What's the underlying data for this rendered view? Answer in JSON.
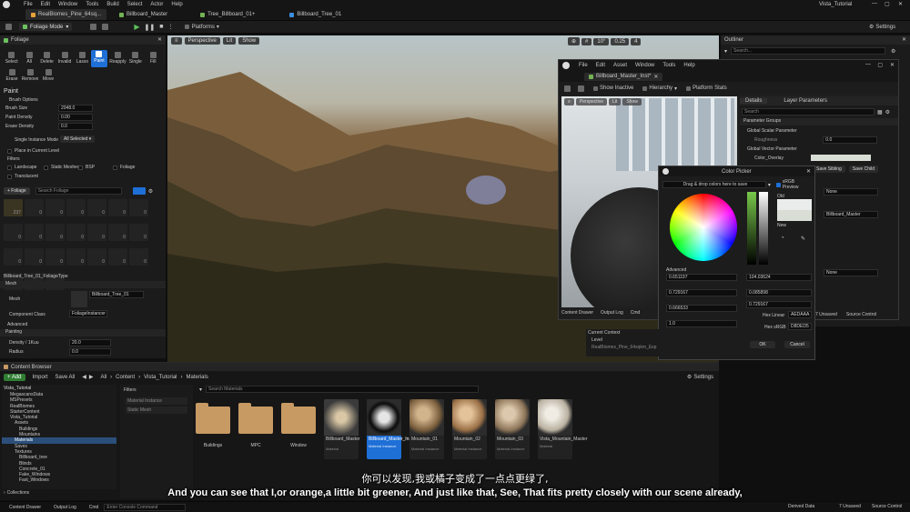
{
  "menubar": {
    "items": [
      "File",
      "Edit",
      "Window",
      "Tools",
      "Build",
      "Select",
      "Actor",
      "Help"
    ],
    "app_title": "Vista_Tutorial"
  },
  "tabs": [
    "RealBiomes_Pine_64sq...",
    "Billboard_Master",
    "Tree_Billboard_01+",
    "Billboard_Tree_01"
  ],
  "toolbar": {
    "mode": "Foliage Mode",
    "platforms": "Platforms",
    "settings": "Settings"
  },
  "viewport": {
    "perspective": "Perspective",
    "lit": "Lit",
    "show": "Show",
    "fov": "10°",
    "scale": "0.25",
    "snap": "4"
  },
  "foliage_panel": {
    "title": "Foliage",
    "tools": [
      "Select",
      "All",
      "Delete",
      "Invalid",
      "Lasso",
      "Paint",
      "Reapply",
      "Single",
      "Fill",
      "Erase",
      "Remove",
      "Move"
    ],
    "section_paint": "Paint",
    "brush_options": "Brush Options",
    "brush_size_label": "Brush Size",
    "brush_size": "2048.0",
    "paint_density_label": "Paint Density",
    "paint_density": "0.00",
    "erase_density_label": "Erase Density",
    "erase_density": "0.0",
    "single_instance_mode": "Single Instance Mode",
    "all_selected": "All Selected",
    "place_in_level": "Place in Current Level",
    "filters": "Filters",
    "filter_items": [
      "Landscape",
      "Static Meshes",
      "BSP",
      "Foliage",
      "Translucent"
    ],
    "add_foliage": "+ Foliage",
    "search_placeholder": "Search Foliage",
    "grid_counts": [
      "237",
      "0",
      "0",
      "0",
      "0",
      "0",
      "0",
      "0",
      "0",
      "0",
      "0",
      "0",
      "0",
      "0",
      "0",
      "0",
      "0",
      "0",
      "0",
      "0",
      "0",
      "0",
      "0",
      "0"
    ],
    "foliage_type_title": "Billboard_Tree_01_FoliageType",
    "mesh_section": "Mesh",
    "mesh_label": "Mesh",
    "mesh_value": "Billboard_Tree_01",
    "component_class_label": "Component Class",
    "component_class_value": "FoliageInstancer",
    "advanced": "Advanced",
    "painting": "Painting",
    "density_label": "Density / 1Kuu",
    "density_value": "20.0",
    "radius_label": "Radius",
    "radius_value": "0.0"
  },
  "outliner": {
    "title": "Outliner",
    "search_placeholder": "Search..."
  },
  "material_window": {
    "menu": [
      "File",
      "Edit",
      "Asset",
      "Window",
      "Tools",
      "Help"
    ],
    "tab": "Billboard_Master_Inst*",
    "buttons": [
      "Show Inactive",
      "Hierarchy",
      "Platform Stats"
    ],
    "viewport_perspective": "Perspective",
    "viewport_lit": "Lit",
    "viewport_show": "Show",
    "details": "Details",
    "layer_parameters": "Layer Parameters",
    "search_placeholder": "Search",
    "parameter_groups": "Parameter Groups",
    "global_scalar": "Global Scalar Parameter",
    "roughness": "Roughness",
    "roughness_val": "0.0",
    "global_vector": "Global Vector Parameter",
    "color_overlay": "Color_Overlay",
    "save_sibling": "Save Sibling",
    "save_child": "Save Child",
    "none1": "None",
    "billboard_master": "Billboard_Master",
    "none2": "None",
    "content_drawer": "Content Drawer",
    "output_log": "Output Log",
    "cmd": "Cmd"
  },
  "color_picker": {
    "title": "Color Picker",
    "hint": "Drag & drop colors here to save",
    "srgb_preview": "sRGB Preview",
    "old": "Old",
    "new": "New",
    "advanced": "Advanced",
    "r": "0.651197",
    "g": "0.729167",
    "b": "0.666533",
    "a": "1.0",
    "h": "104.03624",
    "s": "0.085898",
    "v": "0.729167",
    "hex_linear_label": "Hex Linear",
    "hex_linear": "AEDAAA",
    "hex_srgb_label": "Hex sRGB",
    "hex_srgb": "D8DED5",
    "ok": "OK",
    "cancel": "Cancel"
  },
  "current_context": {
    "title": "Current Context",
    "level": "Level",
    "level_name": "RealBiomes_Pine_64sqkm_Exp"
  },
  "right_status": {
    "unsaved": "7 Unsaved",
    "source_control": "Source Control"
  },
  "content_browser": {
    "title": "Content Browser",
    "add": "+ Add",
    "import": "Import",
    "save_all": "Save All",
    "breadcrumb": [
      "All",
      "Content",
      "Vista_Tutorial",
      "Materials"
    ],
    "settings": "Settings",
    "search_placeholder": "Search Materials",
    "tree_root": "Vista_Tutorial",
    "tree": [
      "MegascansData",
      "MSPresets",
      "RealBiomes",
      "StarterContent",
      "Vista_Tutorial",
      "Assets",
      "Buildings",
      "Mountains",
      "Materials",
      "Saves",
      "Textures",
      "Billboard_tree",
      "Blinds",
      "Concrete_01",
      "Fake_Windows",
      "Fast_Windows"
    ],
    "filters_title": "Filters",
    "filter_chips": [
      "Material Instance",
      "Static Mesh"
    ],
    "folders": [
      "Buildings",
      "MPC",
      "Window"
    ],
    "assets": [
      {
        "name": "Billboard_Master",
        "type": "Material"
      },
      {
        "name": "Billboard_Master_Inst",
        "type": "Material Instance"
      },
      {
        "name": "Mountain_01",
        "type": "Material Instance"
      },
      {
        "name": "Mountain_02",
        "type": "Material Instance"
      },
      {
        "name": "Mountain_03",
        "type": "Material Instance"
      },
      {
        "name": "Vista_Mountain_Master",
        "type": "Material"
      }
    ],
    "collections": "Collections"
  },
  "statusbar": {
    "content_drawer": "Content Drawer",
    "output_log": "Output Log",
    "cmd": "Cmd",
    "console_placeholder": "Enter Console Command",
    "derived_data": "Derived Data",
    "unsaved": "7 Unsaved",
    "source_control": "Source Control"
  },
  "subtitles": {
    "chinese": "你可以发现,我或橘子变成了一点点更绿了,",
    "english": "And you can see that I,or orange,a little bit greener, And just like that, See, That fits pretty closely with our scene already,"
  }
}
